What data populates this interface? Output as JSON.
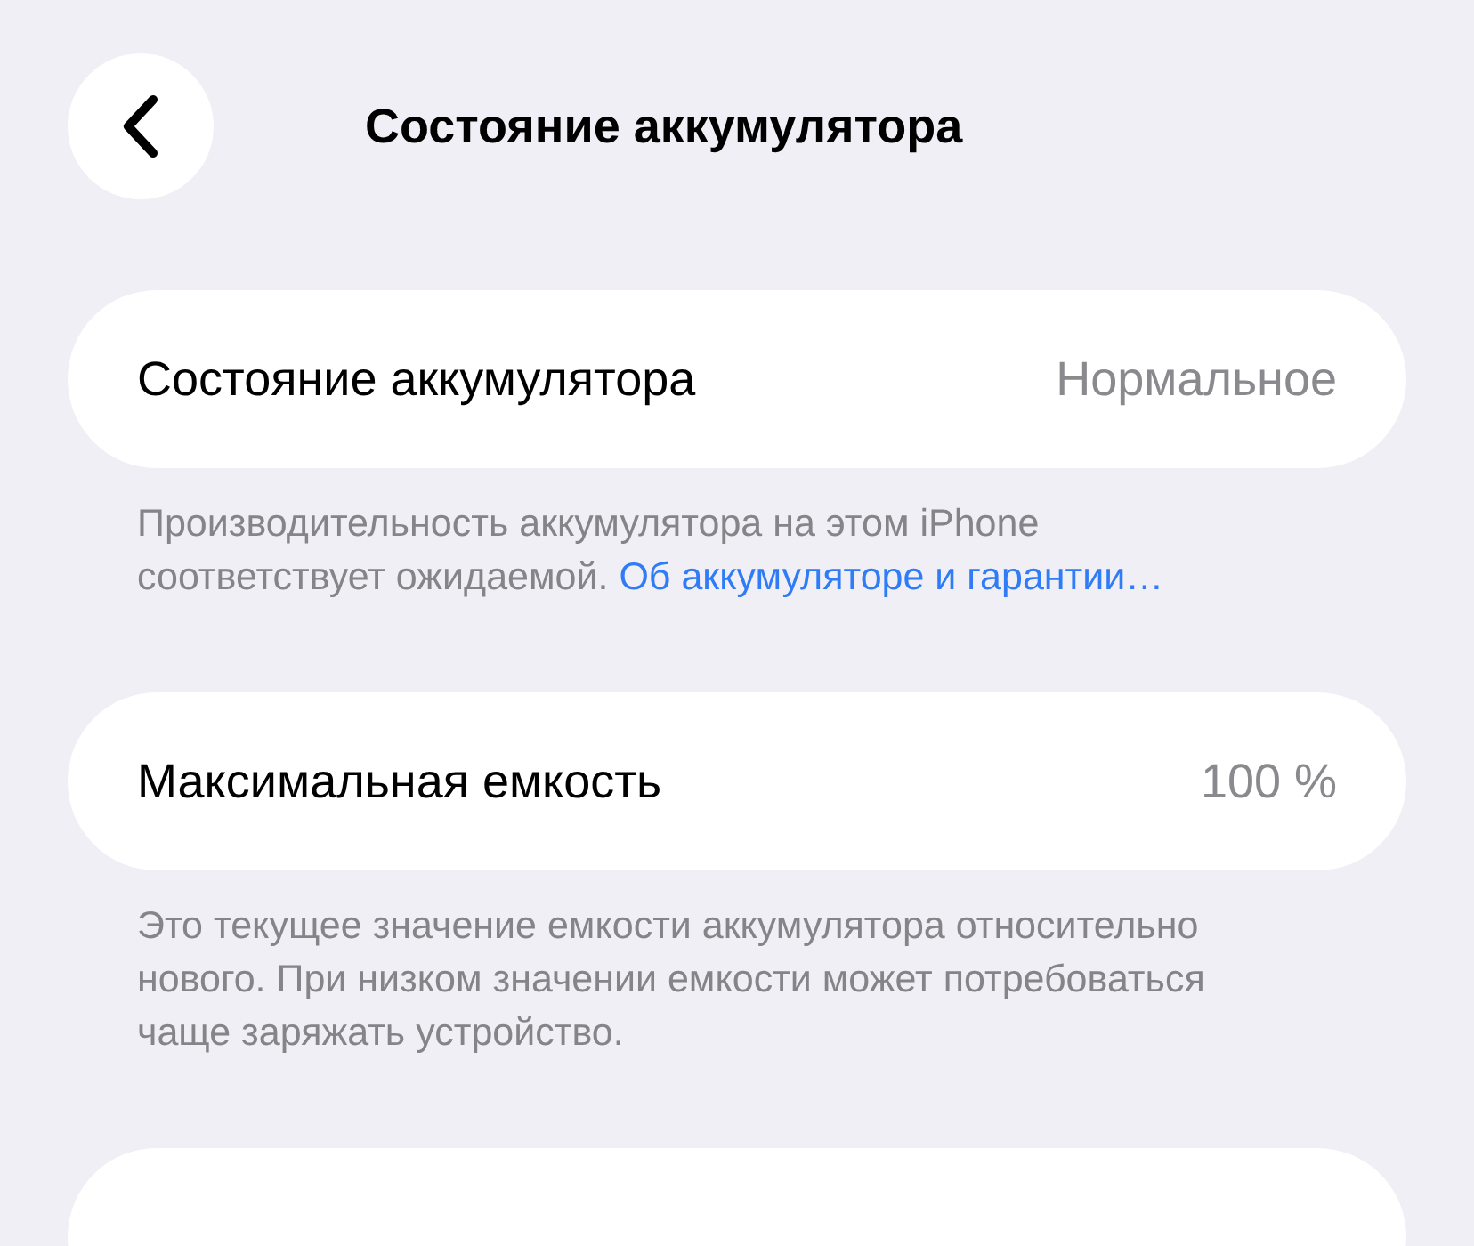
{
  "header": {
    "title": "Состояние аккумулятора"
  },
  "sections": [
    {
      "label": "Состояние аккумулятора",
      "value": "Нормальное",
      "footnote": "Производительность аккумулятора на этом iPhone соответствует ожидаемой.",
      "link": "Об аккумуляторе и гарантии…"
    },
    {
      "label": "Максимальная емкость",
      "value": "100 %",
      "footnote": "Это текущее значение емкости аккумулятора относительно нового. При низком значении емкости может потребоваться чаще заряжать устройство."
    }
  ]
}
